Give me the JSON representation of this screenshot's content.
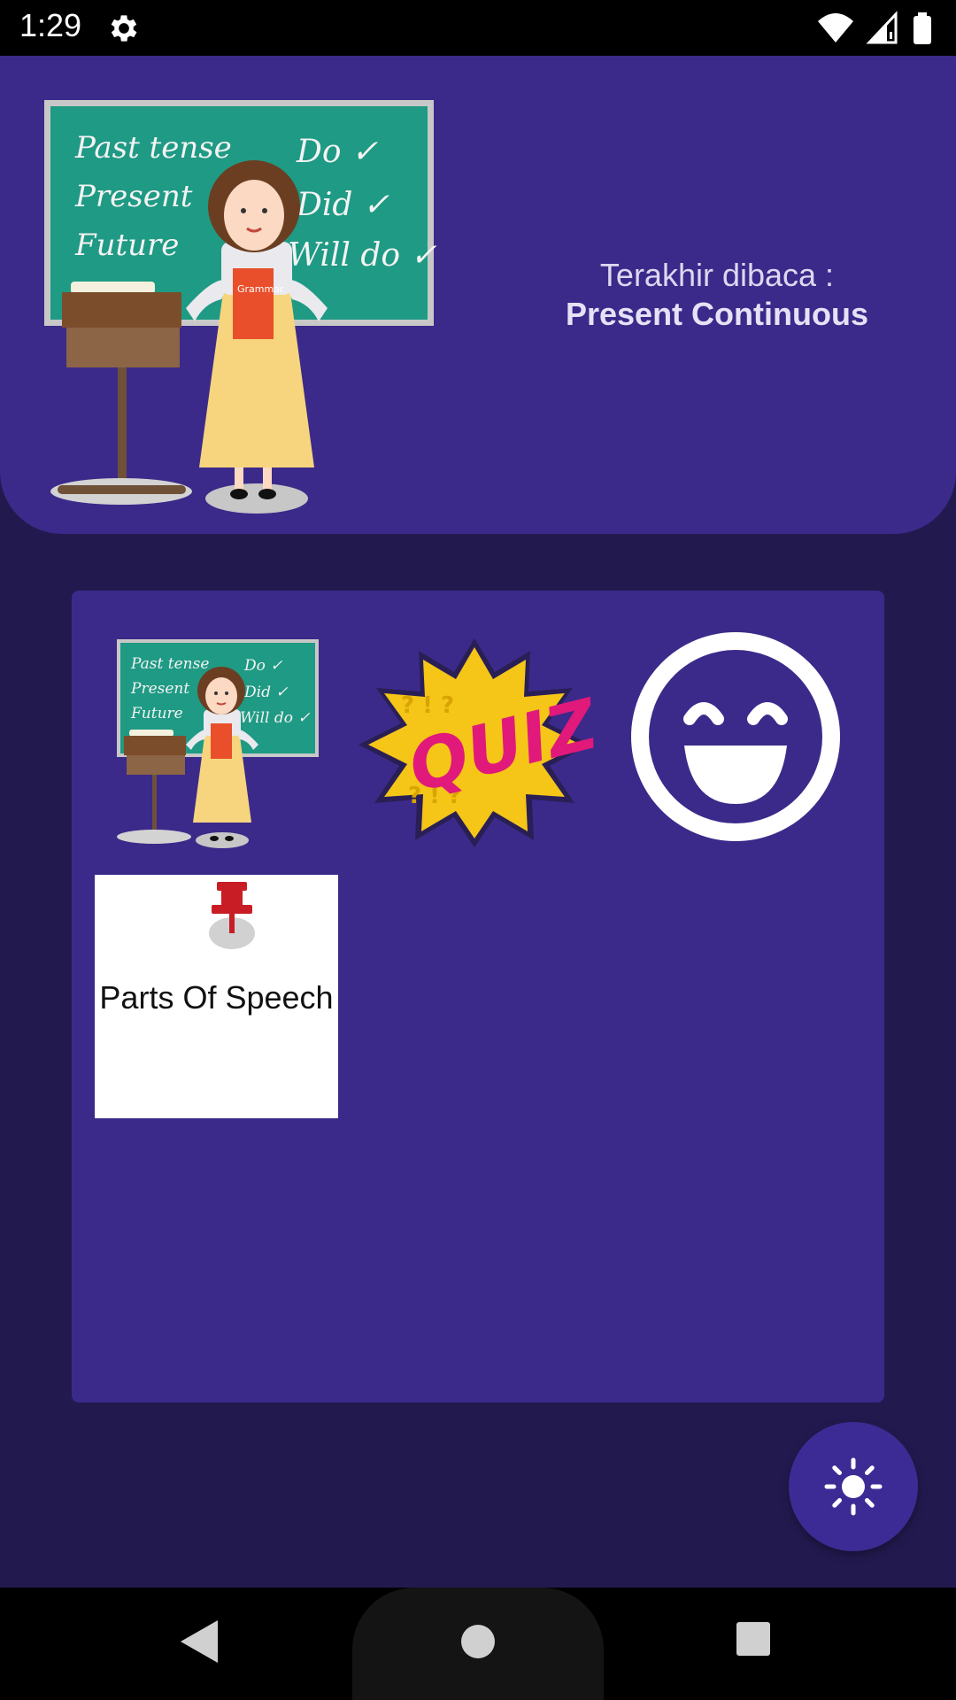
{
  "status_bar": {
    "time": "1:29"
  },
  "header": {
    "last_read_label": "Terakhir dibaca :",
    "last_read_title": "Present Continuous",
    "chalkboard_lines": [
      "Past tense",
      "Present",
      "Future",
      "Do",
      "Did",
      "Will do"
    ],
    "book_title": "Grammar"
  },
  "menu": {
    "tiles": [
      {
        "id": "teacher",
        "icon": "teacher-illustration"
      },
      {
        "id": "quiz",
        "icon": "quiz-badge",
        "text": "QUIZ"
      },
      {
        "id": "fun",
        "icon": "laughing-face-icon"
      },
      {
        "id": "parts",
        "icon": "pushpin-icon",
        "label": "Parts Of Speech"
      }
    ]
  },
  "fab": {
    "icon": "brightness-icon"
  },
  "nav": {
    "back_icon": "back-triangle-icon",
    "home_icon": "home-circle-icon",
    "recents_icon": "recents-square-icon"
  },
  "colors": {
    "background": "#221a4f",
    "header": "#3b2a8a",
    "panel": "#3b2a8a",
    "fab": "#3d2b95",
    "chalkboard": "#1f9a84",
    "quiz_yellow": "#f5c518",
    "quiz_pink": "#e0197a",
    "pin_red": "#c81d25"
  }
}
